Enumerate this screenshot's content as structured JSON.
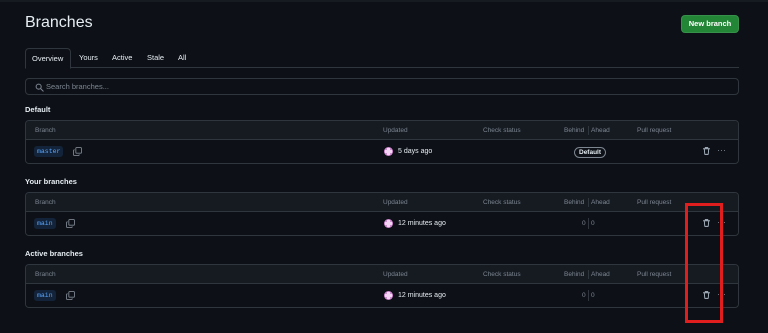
{
  "page": {
    "title": "Branches"
  },
  "header": {
    "new_branch_label": "New branch"
  },
  "tabs": [
    {
      "label": "Overview"
    },
    {
      "label": "Yours"
    },
    {
      "label": "Active"
    },
    {
      "label": "Stale"
    },
    {
      "label": "All"
    }
  ],
  "search": {
    "placeholder": "Search branches..."
  },
  "columns": {
    "branch": "Branch",
    "updated": "Updated",
    "check_status": "Check status",
    "behind": "Behind",
    "ahead": "Ahead",
    "pull_request": "Pull request"
  },
  "sections": {
    "default": {
      "title": "Default",
      "row": {
        "branch": "master",
        "updated": "5 days ago",
        "badge": "Default"
      }
    },
    "yours": {
      "title": "Your branches",
      "row": {
        "branch": "main",
        "updated": "12 minutes ago",
        "behind": "0",
        "ahead": "0"
      }
    },
    "active": {
      "title": "Active branches",
      "row": {
        "branch": "main",
        "updated": "12 minutes ago",
        "behind": "0",
        "ahead": "0"
      }
    }
  },
  "icons": {
    "search": "search-icon",
    "copy": "copy-icon",
    "trash": "trash-icon",
    "more": "kebab-horizontal-icon",
    "avatar": "avatar"
  },
  "colors": {
    "background": "#0d1117",
    "primary_button": "#238636",
    "branch_chip_text": "#58a6ff",
    "highlight": "#e01e1e"
  }
}
